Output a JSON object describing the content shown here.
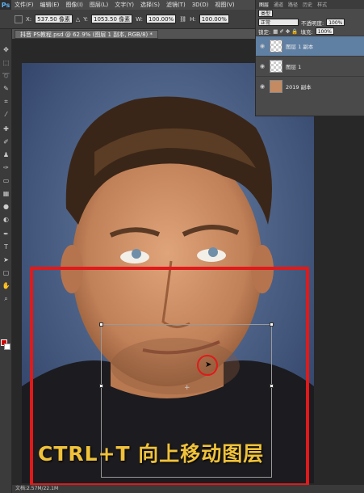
{
  "menu": {
    "logo": "Ps",
    "items": [
      "文件(F)",
      "编辑(E)",
      "图像(I)",
      "图层(L)",
      "文字(Y)",
      "选择(S)",
      "滤镜(T)",
      "3D(D)",
      "视图(V)"
    ]
  },
  "options": {
    "x_label": "X:",
    "x_value": "537.50 像素",
    "y_label": "Y:",
    "y_value": "1053.50 像素",
    "w_label": "W:",
    "w_value": "100.00%",
    "h_label": "H:",
    "h_value": "100.00%"
  },
  "document": {
    "tab_title": "抖音 PS教程.psd @ 62.9% (图层 1 副本, RGB/8) *"
  },
  "layers_panel": {
    "tabs": [
      "图层",
      "通道",
      "路径",
      "历史",
      "样式"
    ],
    "kind": "类型",
    "blend_mode": "正常",
    "opacity_label": "不透明度:",
    "opacity_value": "100%",
    "lock_label": "锁定:",
    "fill_label": "填充:",
    "fill_value": "100%",
    "layers": [
      {
        "name": "图层 1 副本",
        "selected": true
      },
      {
        "name": "图层 1",
        "selected": false
      },
      {
        "name": "2019 副本",
        "selected": false
      }
    ]
  },
  "caption": "CTRL+T  向上移动图层",
  "status": {
    "text": "文档:2.57M/22.1M"
  },
  "colors": {
    "highlight_red": "#e01a1a",
    "caption_yellow": "#f0c23a",
    "foreground": "#d10000",
    "background": "#ffffff"
  }
}
